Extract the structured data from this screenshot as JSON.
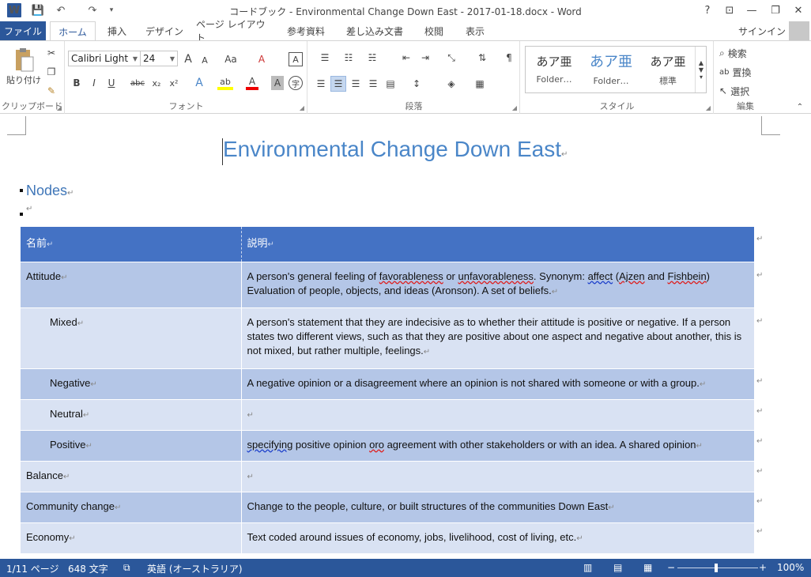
{
  "window": {
    "title": "コードブック - Environmental Change Down East - 2017-01-18.docx - Word",
    "help": "?",
    "ribbon_display": "⊡",
    "minimize": "—",
    "restore": "❐",
    "close": "✕"
  },
  "qat": {
    "app_icon": "W",
    "save": "💾",
    "undo": "↶",
    "redo": "↷",
    "customize": "▾"
  },
  "tabs": [
    {
      "label": "ファイル"
    },
    {
      "label": "ホーム"
    },
    {
      "label": "挿入"
    },
    {
      "label": "デザイン"
    },
    {
      "label": "ページ レイアウト"
    },
    {
      "label": "参考資料"
    },
    {
      "label": "差し込み文書"
    },
    {
      "label": "校閲"
    },
    {
      "label": "表示"
    }
  ],
  "signin": "サインイン",
  "ribbon": {
    "clipboard": {
      "label": "クリップボード",
      "paste": "貼り付け"
    },
    "font": {
      "label": "フォント",
      "font_name": "Calibri Light",
      "font_size": "24",
      "grow": "A",
      "shrink": "A",
      "case": "Aa",
      "clear": "A",
      "border_char": "A",
      "bold": "B",
      "italic": "I",
      "underline": "U",
      "strike": "abc",
      "subscript": "x₂",
      "superscript": "x²",
      "effects": "A",
      "highlight": "ab",
      "color": "A",
      "shade": "A",
      "enclose": "字"
    },
    "paragraph": {
      "label": "段落"
    },
    "styles": {
      "label": "スタイル",
      "items": [
        {
          "sample": "あア亜",
          "name": "Folder…"
        },
        {
          "sample": "あア亜",
          "name": "Folder…"
        },
        {
          "sample": "あア亜",
          "name": "標準"
        }
      ]
    },
    "editing": {
      "label": "編集",
      "find": "検索",
      "replace": "置換",
      "select": "選択"
    }
  },
  "document": {
    "title": "Environmental Change Down East",
    "heading": "Nodes",
    "para_mark": "↵",
    "table": {
      "headers": [
        "名前",
        "説明"
      ],
      "rows": [
        {
          "name": "Attitude",
          "desc": ""
        },
        {
          "name": "Mixed",
          "desc": "A person's statement that they are indecisive as to whether their attitude is positive or negative. If a person states two different views, such as that they are positive about one aspect and negative about another, this is not mixed, but rather multiple, feelings."
        },
        {
          "name": "Negative",
          "desc": "A negative opinion or a disagreement where an opinion is not shared with someone or with a group."
        },
        {
          "name": "Neutral",
          "desc": ""
        },
        {
          "name": "Positive",
          "desc": ""
        },
        {
          "name": "Balance",
          "desc": ""
        },
        {
          "name": "Community change",
          "desc": "Change to the people, culture, or built structures of the communities Down East"
        },
        {
          "name": "Economy",
          "desc": "Text coded around issues of economy, jobs, livelihood, cost of living, etc."
        }
      ],
      "attitude_desc_parts": [
        "A person's general feeling of ",
        "favorableness",
        " or ",
        "unfavorableness",
        ". Synonym: ",
        "affect",
        "  (",
        "Ajzen",
        " and ",
        "Fishbein",
        ") Evaluation of people, objects, and ideas (Aronson). A set of beliefs."
      ],
      "positive_desc_parts": [
        "specifying",
        " positive opinion ",
        "oro",
        " agreement with other stakeholders or with an idea. A shared opinion"
      ]
    }
  },
  "status": {
    "page": "1/11 ページ",
    "words": "648 文字",
    "language": "英語 (オーストラリア)",
    "zoom": "100%",
    "zoom_minus": "−",
    "zoom_plus": "+",
    "zoom_level": 1.0
  }
}
